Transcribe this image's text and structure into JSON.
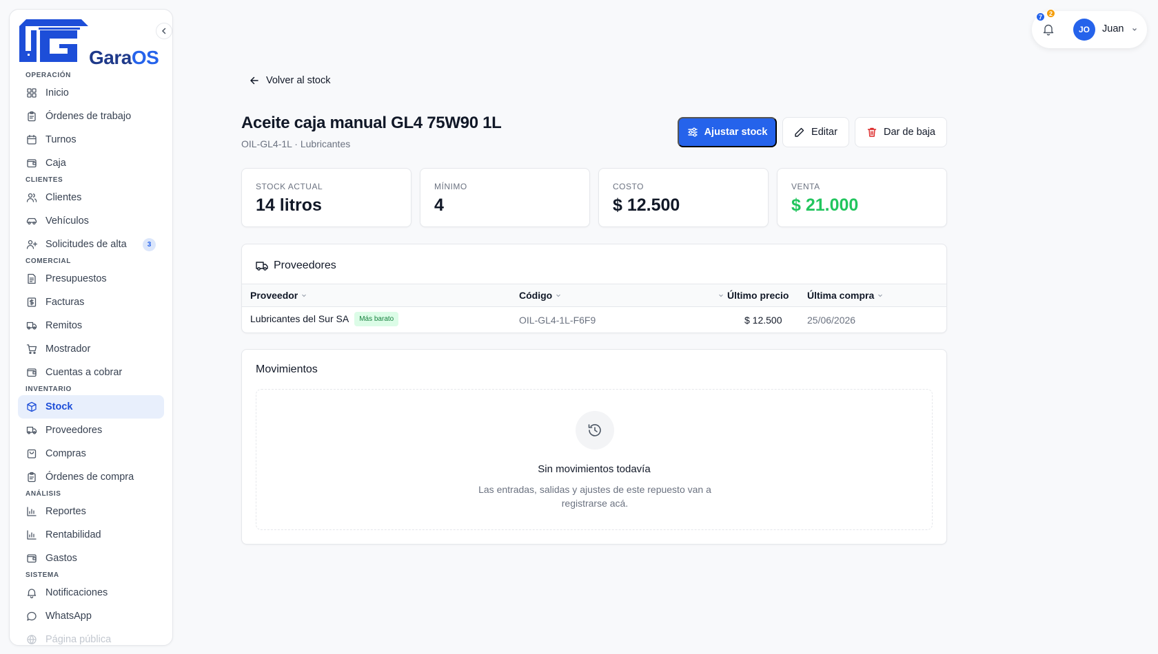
{
  "brand": {
    "name_part1": "Gara",
    "name_part2": "OS"
  },
  "sidebar": {
    "sections": [
      {
        "title": "OPERACIÓN",
        "items": [
          {
            "label": "Inicio",
            "icon": "grid-icon"
          },
          {
            "label": "Órdenes de trabajo",
            "icon": "clipboard-icon"
          },
          {
            "label": "Turnos",
            "icon": "calendar-icon"
          },
          {
            "label": "Caja",
            "icon": "wallet-icon"
          }
        ]
      },
      {
        "title": "CLIENTES",
        "items": [
          {
            "label": "Clientes",
            "icon": "users-icon"
          },
          {
            "label": "Vehículos",
            "icon": "car-icon"
          },
          {
            "label": "Solicitudes de alta",
            "icon": "user-plus-icon",
            "badge": "3"
          }
        ]
      },
      {
        "title": "COMERCIAL",
        "items": [
          {
            "label": "Presupuestos",
            "icon": "document-icon"
          },
          {
            "label": "Facturas",
            "icon": "receipt-icon"
          },
          {
            "label": "Remitos",
            "icon": "truck-icon"
          },
          {
            "label": "Mostrador",
            "icon": "cart-icon"
          },
          {
            "label": "Cuentas a cobrar",
            "icon": "wallet-icon"
          }
        ]
      },
      {
        "title": "INVENTARIO",
        "items": [
          {
            "label": "Stock",
            "icon": "box-icon",
            "active": true
          },
          {
            "label": "Proveedores",
            "icon": "truck-icon"
          },
          {
            "label": "Compras",
            "icon": "shopping-bag-icon"
          },
          {
            "label": "Órdenes de compra",
            "icon": "clipboard-icon"
          }
        ]
      },
      {
        "title": "ANÁLISIS",
        "items": [
          {
            "label": "Reportes",
            "icon": "bar-chart-icon"
          },
          {
            "label": "Rentabilidad",
            "icon": "bar-chart-icon"
          },
          {
            "label": "Gastos",
            "icon": "wallet-icon"
          }
        ]
      },
      {
        "title": "SISTEMA",
        "items": [
          {
            "label": "Notificaciones",
            "icon": "bell-icon"
          },
          {
            "label": "WhatsApp",
            "icon": "chat-icon"
          },
          {
            "label": "Página pública",
            "icon": "globe-icon",
            "faded": true
          }
        ]
      }
    ]
  },
  "topbar": {
    "notification_count_blue": "7",
    "notification_count_orange": "2",
    "avatar_initials": "JO",
    "user_name": "Juan"
  },
  "page": {
    "back_label": "Volver al stock",
    "title": "Aceite caja manual GL4 75W90 1L",
    "subtitle": "OIL-GL4-1L · Lubricantes",
    "actions": {
      "adjust": "Ajustar stock",
      "edit": "Editar",
      "delete": "Dar de baja"
    }
  },
  "stats": [
    {
      "label": "STOCK ACTUAL",
      "value": "14 litros"
    },
    {
      "label": "MÍNIMO",
      "value": "4"
    },
    {
      "label": "COSTO",
      "value": "$ 12.500"
    },
    {
      "label": "VENTA",
      "value": "$ 21.000",
      "color": "#22c55e"
    }
  ],
  "suppliers": {
    "title": "Proveedores",
    "columns": [
      "Proveedor",
      "Código",
      "Último precio",
      "Última compra"
    ],
    "rows": [
      {
        "proveedor": "Lubricantes del Sur SA",
        "tag": "Más barato",
        "codigo": "OIL-GL4-1L-F6F9",
        "precio": "$ 12.500",
        "fecha": "25/06/2026"
      }
    ]
  },
  "movements": {
    "title": "Movimientos",
    "empty_title": "Sin movimientos todavía",
    "empty_desc": "Las entradas, salidas y ajustes de este repuesto van a registrarse acá."
  },
  "colors": {
    "primary": "#2563eb",
    "success": "#22c55e",
    "danger": "#dc2626"
  }
}
